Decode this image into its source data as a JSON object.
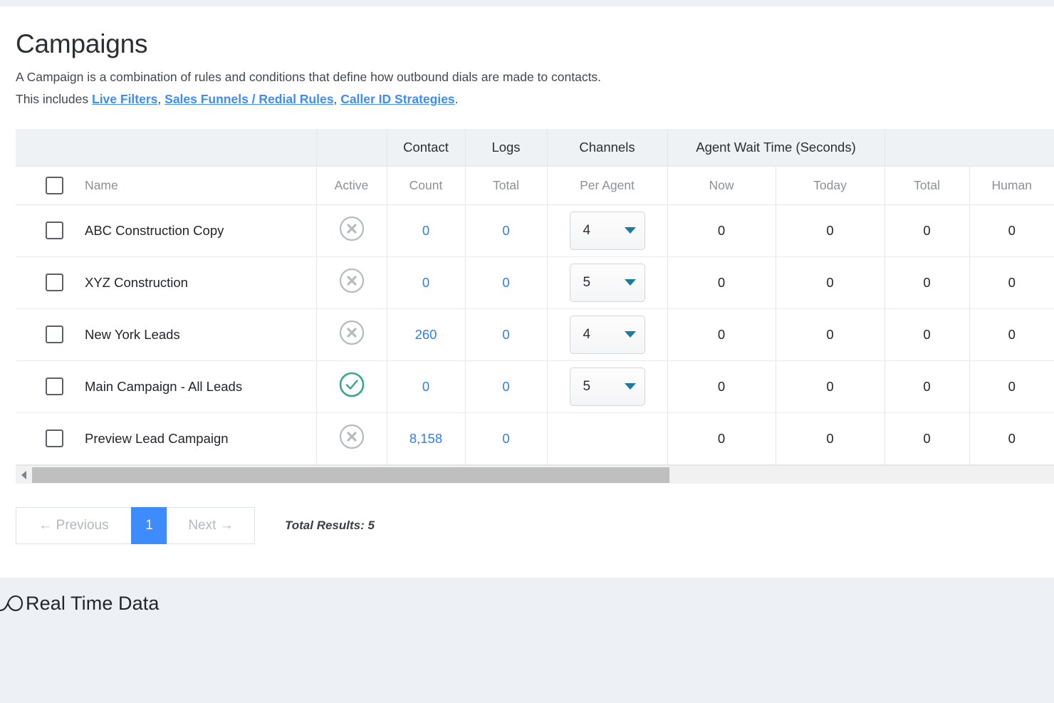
{
  "page": {
    "title": "Campaigns",
    "description_line1": "A Campaign is a combination of rules and conditions that define how outbound dials are made to contacts.",
    "description_prefix": "This includes ",
    "description_suffix": ".",
    "links": [
      {
        "label": "Live Filters"
      },
      {
        "label": "Sales Funnels / Redial Rules"
      },
      {
        "label": "Caller ID Strategies"
      }
    ],
    "separator": ", "
  },
  "colors": {
    "link": "#3d8bfd",
    "number_link": "#2f80ed",
    "active_yes": "#34a887",
    "active_no": "#b5bbc0",
    "select_caret": "#1b7a9e",
    "page_active_bg": "#3d8bfd",
    "header_bg": "#eef2f5",
    "strip_bg": "#edf1f5",
    "scrollbar_thumb": "#bfbfbf"
  },
  "table": {
    "group_headers": [
      {
        "label": "",
        "name": "group-blank-name"
      },
      {
        "label": "",
        "name": "group-blank-active"
      },
      {
        "label": "Contact",
        "name": "group-contact"
      },
      {
        "label": "Logs",
        "name": "group-logs"
      },
      {
        "label": "Channels",
        "name": "group-channels"
      },
      {
        "label": "Agent Wait Time (Seconds)",
        "name": "group-agent-wait-time"
      },
      {
        "label": "",
        "name": "group-blank-right"
      }
    ],
    "columns": [
      {
        "key": "name",
        "label": "Name"
      },
      {
        "key": "active",
        "label": "Active"
      },
      {
        "key": "contact_count",
        "label": "Count"
      },
      {
        "key": "logs_total",
        "label": "Total"
      },
      {
        "key": "channels_per_agent",
        "label": "Per Agent"
      },
      {
        "key": "wait_now",
        "label": "Now"
      },
      {
        "key": "wait_today",
        "label": "Today"
      },
      {
        "key": "total",
        "label": "Total"
      },
      {
        "key": "human",
        "label": "Human"
      }
    ],
    "select_all_checkbox": false,
    "rows": [
      {
        "checked": false,
        "name": "ABC Construction Copy",
        "active": false,
        "active_icon": "circle-x-icon",
        "contact_count": "0",
        "logs_total": "0",
        "channels_per_agent": "4",
        "has_select": true,
        "wait_now": "0",
        "wait_today": "0",
        "total": "0",
        "human": "0"
      },
      {
        "checked": false,
        "name": "XYZ Construction",
        "active": false,
        "active_icon": "circle-x-icon",
        "contact_count": "0",
        "logs_total": "0",
        "channels_per_agent": "5",
        "has_select": true,
        "wait_now": "0",
        "wait_today": "0",
        "total": "0",
        "human": "0"
      },
      {
        "checked": false,
        "name": "New York Leads",
        "active": false,
        "active_icon": "circle-x-icon",
        "contact_count": "260",
        "logs_total": "0",
        "channels_per_agent": "4",
        "has_select": true,
        "wait_now": "0",
        "wait_today": "0",
        "total": "0",
        "human": "0"
      },
      {
        "checked": false,
        "name": "Main Campaign - All Leads",
        "active": true,
        "active_icon": "circle-check-icon",
        "contact_count": "0",
        "logs_total": "0",
        "channels_per_agent": "5",
        "has_select": true,
        "wait_now": "0",
        "wait_today": "0",
        "total": "0",
        "human": "0"
      },
      {
        "checked": false,
        "name": "Preview Lead Campaign",
        "active": false,
        "active_icon": "circle-x-icon",
        "contact_count": "8,158",
        "logs_total": "0",
        "channels_per_agent": "",
        "has_select": false,
        "wait_now": "0",
        "wait_today": "0",
        "total": "0",
        "human": "0"
      }
    ]
  },
  "pagination": {
    "previous_label": "← Previous",
    "current_page": "1",
    "next_label": "Next →",
    "total_results": "Total Results: 5"
  },
  "bottom": {
    "real_time_data_label": "Real Time Data",
    "icon": "infinity-icon"
  }
}
